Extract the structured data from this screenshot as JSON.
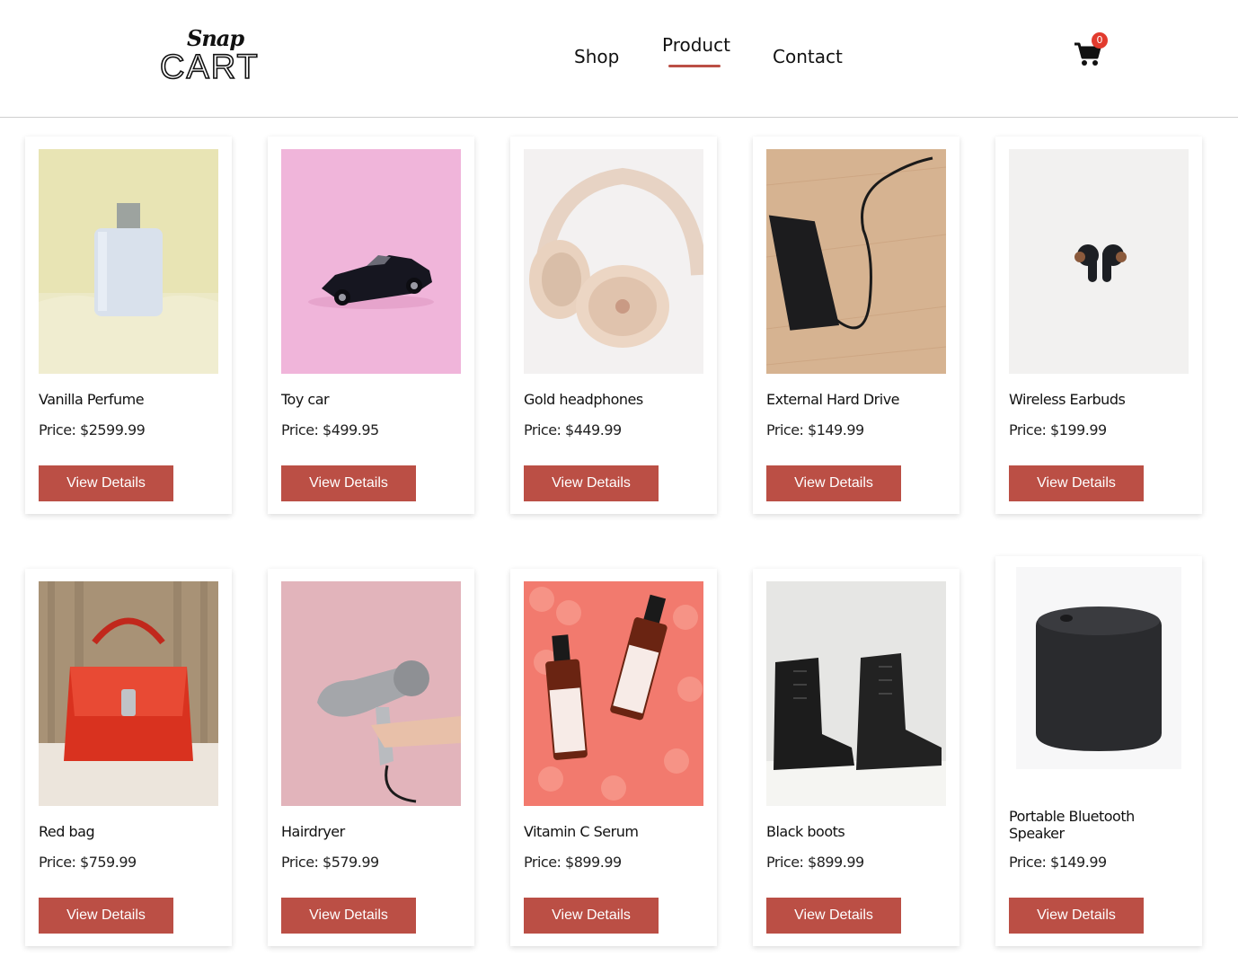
{
  "header": {
    "logo_script": "Snap",
    "logo_main": "CART",
    "nav": [
      {
        "label": "Shop"
      },
      {
        "label": "Product"
      },
      {
        "label": "Contact"
      }
    ],
    "cart_count": "0",
    "accent_color": "#bb4f45"
  },
  "products": [
    {
      "name": "Vanilla Perfume",
      "price": "Price: $2599.99",
      "button": "View Details"
    },
    {
      "name": "Toy car",
      "price": "Price: $499.95",
      "button": "View Details"
    },
    {
      "name": "Gold headphones",
      "price": "Price: $449.99",
      "button": "View Details"
    },
    {
      "name": "External Hard Drive",
      "price": "Price: $149.99",
      "button": "View Details"
    },
    {
      "name": "Wireless Earbuds",
      "price": "Price: $199.99",
      "button": "View Details"
    },
    {
      "name": "Red bag",
      "price": "Price: $759.99",
      "button": "View Details"
    },
    {
      "name": "Hairdryer",
      "price": "Price: $579.99",
      "button": "View Details"
    },
    {
      "name": "Vitamin C Serum",
      "price": "Price: $899.99",
      "button": "View Details"
    },
    {
      "name": "Black boots",
      "price": "Price: $899.99",
      "button": "View Details"
    },
    {
      "name": "Portable Bluetooth Speaker",
      "price": "Price: $149.99",
      "button": "View Details"
    }
  ]
}
